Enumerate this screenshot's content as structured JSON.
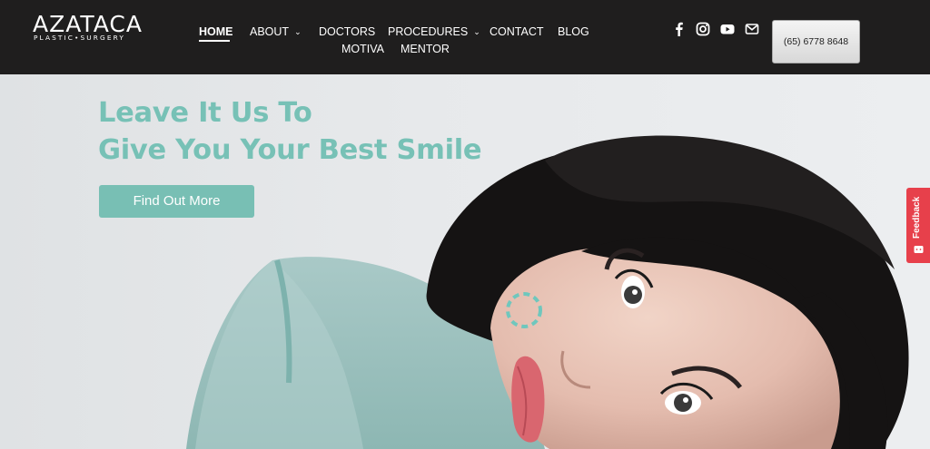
{
  "brand": {
    "name": "AZATACA",
    "tagline": "PLASTIC•SURGERY"
  },
  "nav": {
    "items": [
      {
        "label": "HOME",
        "active": true
      },
      {
        "label": "ABOUT",
        "dropdown": true
      },
      {
        "label": "DOCTORS"
      },
      {
        "label": "PROCEDURES",
        "dropdown": true
      },
      {
        "label": "CONTACT"
      },
      {
        "label": "BLOG"
      },
      {
        "label": "MOTIVA"
      },
      {
        "label": "MENTOR"
      }
    ],
    "chevron": "⌄"
  },
  "social": {
    "icons": [
      "facebook-icon",
      "instagram-icon",
      "youtube-icon",
      "email-icon"
    ]
  },
  "phone": {
    "label": "(65) 6778 8648"
  },
  "hero": {
    "title_line1": "Leave It Us To",
    "title_line2": "Give You Your Best Smile",
    "cta_label": "Find Out More"
  },
  "feedback": {
    "label": "Feedback"
  },
  "colors": {
    "header_bg": "#1f1e1e",
    "accent": "#78bfb4",
    "feedback": "#e7404b"
  }
}
